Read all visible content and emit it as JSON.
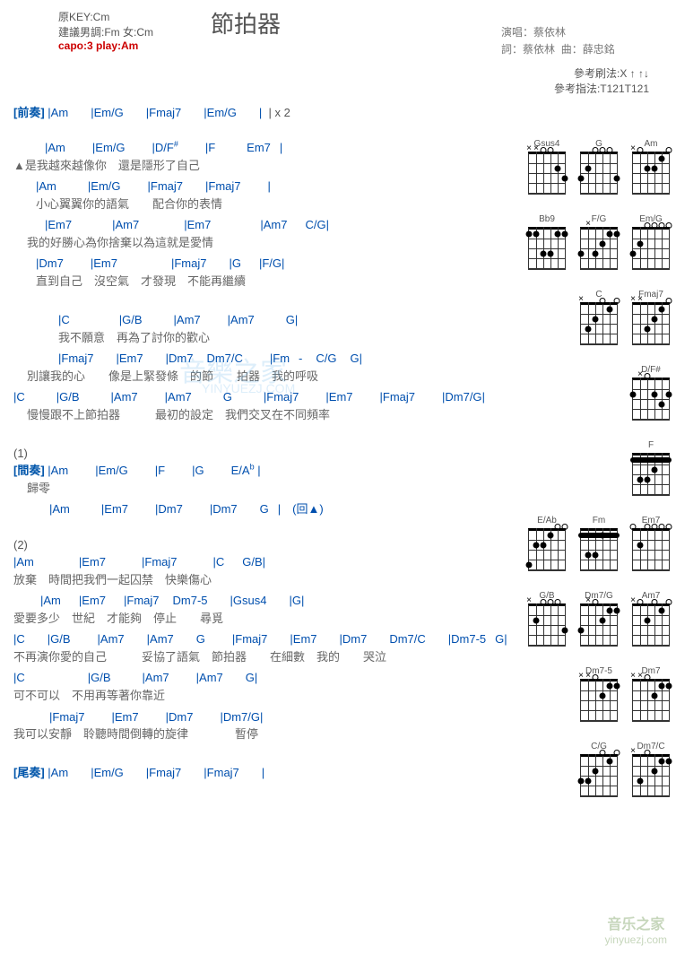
{
  "header": {
    "key": "原KEY:Cm",
    "suggest": "建議男調:Fm 女:Cm",
    "capo": "capo:3 play:Am",
    "title": "節拍器",
    "perf_lbl": "演唱：",
    "perf": "蔡依林",
    "lyric_lbl": "詞：",
    "lyric": "蔡依林",
    "comp_lbl": "曲：",
    "comp": "薛忠銘"
  },
  "refs": {
    "strum_lbl": "參考刷法:",
    "strum": "X ↑  ↑↓",
    "pick_lbl": "參考指法:",
    "pick": "T121T121",
    "bold_part": "↑"
  },
  "chart_data": {
    "type": "chord-sheet",
    "sections": [
      {
        "label": "[前奏]",
        "bars": [
          "|Am",
          "|Em/G",
          "|Fmaj7",
          "|Em/G",
          "|"
        ],
        "repeat": "| x 2"
      },
      {
        "label": "▲",
        "pairs": [
          {
            "chords": [
              "|Am",
              "|Em/G",
              "|D/F",
              "|F",
              "Em7",
              "|"
            ],
            "sup": "#",
            "sup_after": 2,
            "pad": [
              30,
              30,
              30,
              35,
              10,
              0
            ],
            "lyric": "是我越來越像你　還是隱形了自己"
          },
          {
            "chords": [
              "|Am",
              "|Em/G",
              "|Fmaj7",
              "|Fmaj7",
              "|"
            ],
            "pad": [
              35,
              30,
              25,
              30,
              0
            ],
            "lyric": "小心翼翼你的語氣　　配合你的表情",
            "lpad": 25
          },
          {
            "chords": [
              "|Em7",
              "|Am7",
              "|Em7",
              "|Am7",
              "C/G",
              "|"
            ],
            "pad": [
              45,
              50,
              55,
              20,
              0
            ],
            "lyric": "我的好勝心為你捨棄以為這就是愛情"
          },
          {
            "chords": [
              "|Dm7",
              "|Em7",
              "|Fmaj7",
              "|G",
              "|F/G",
              "|"
            ],
            "pad": [
              30,
              60,
              25,
              20,
              0
            ],
            "lyric": "直到自己　沒空氣　才發現　不能再繼續",
            "lpad": 25
          }
        ]
      },
      {
        "chorus": [
          {
            "chords": [
              "|C",
              "|G/B",
              "|Am7",
              "|Am7",
              "G",
              "|"
            ],
            "pad": [
              55,
              35,
              30,
              35,
              0
            ],
            "lyric": "我不願意　再為了討你的歡心",
            "lpad": 50,
            "cpad": 50
          },
          {
            "chords": [
              "|Fmaj7",
              "|Em7",
              "|Dm7",
              "Dm7/C",
              "|Fm",
              "-",
              "C/G",
              "G",
              "|"
            ],
            "pad": [
              25,
              25,
              15,
              30,
              10,
              15,
              15,
              0
            ],
            "lyric": "別讓我的心　　像是上緊發條　的節　　拍器　我的呼吸",
            "lpad": 15,
            "cpad": 50
          },
          {
            "chords": [
              "|C",
              "|G/B",
              "|Am7",
              "|Am7",
              "G",
              "|Fmaj7",
              "|Em7",
              "|Fmaj7",
              "|Dm7/G",
              "|"
            ],
            "pad": [
              35,
              35,
              30,
              35,
              35,
              30,
              30,
              30,
              0
            ],
            "lyric": "慢慢跟不上節拍器　　　最初的設定　我們交叉在不同頻率",
            "lpad": 15
          }
        ]
      },
      {
        "num": "(1)",
        "label": "[間奏]",
        "bars": [
          "|Am",
          "|Em/G",
          "|F",
          "|G",
          "E/A"
        ],
        "sup": "b",
        "lyric": "歸零",
        "lpad": 15,
        "line2": {
          "chords": [
            "|Am",
            "|Em7",
            "|Dm7",
            "|Dm7",
            "G",
            "|　(回▲)"
          ],
          "pad": [
            35,
            30,
            30,
            25,
            10,
            0
          ],
          "cpad": 40
        }
      },
      {
        "num": "(2)",
        "pairs": [
          {
            "chords": [
              "|Am",
              "|Em7",
              "|Fmaj7",
              "|C",
              "G/B",
              "|"
            ],
            "pad": [
              50,
              40,
              40,
              20,
              0
            ],
            "lyric": "放棄　時間把我們一起囚禁　快樂傷心"
          },
          {
            "chords": [
              "|Am",
              "|Em7",
              "|Fmaj7",
              "Dm7-5",
              "|Gsus4",
              "|G",
              "|"
            ],
            "pad": [
              20,
              20,
              15,
              25,
              25,
              0
            ],
            "lyric": "愛要多少　世紀　才能夠　停止　　尋覓",
            "lpad": 0,
            "cpad": 30
          },
          {
            "chords": [
              "|C",
              "|G/B",
              "|Am7",
              "|Am7",
              "G",
              "|Fmaj7",
              "|Em7",
              "|Dm7",
              "Dm7/C",
              "|Dm7-5",
              "G",
              "|"
            ],
            "pad": [
              25,
              30,
              25,
              25,
              30,
              25,
              25,
              25,
              25,
              10,
              0
            ],
            "lyric": "不再演你愛的自己　　　妥協了語氣　節拍器　　在細數　我的　　哭泣"
          },
          {
            "chords": [
              "|C",
              "|G/B",
              "|Am7",
              "|Am7",
              "G",
              "|"
            ],
            "pad": [
              70,
              35,
              30,
              25,
              0
            ],
            "lyric": "可不可以　不用再等著你靠近"
          },
          {
            "chords": [
              "|Fmaj7",
              "|Em7",
              "|Dm7",
              "|Dm7/G",
              "|"
            ],
            "pad": [
              30,
              30,
              30,
              0
            ],
            "lyric": "我可以安靜　聆聽時間倒轉的旋律　　　　暫停",
            "cpad": 40
          }
        ]
      },
      {
        "label": "[尾奏]",
        "bars": [
          "|Am",
          "|Em/G",
          "|Fmaj7",
          "|Fmaj7",
          "|"
        ]
      }
    ]
  },
  "diags": [
    [
      {
        "n": "Gsus4",
        "d": [
          "m1",
          "m2",
          "o3",
          "o4",
          "df2s5",
          "df3s6"
        ]
      },
      {
        "n": "G",
        "d": [
          "df3s1",
          "df2s2",
          "o3",
          "o4",
          "o5",
          "df3s6"
        ]
      },
      {
        "n": "Am",
        "d": [
          "m1",
          "o2",
          "df2s3",
          "df2s4",
          "df1s5",
          "o6"
        ]
      }
    ],
    [
      {
        "n": "Bb9",
        "d": [
          "df1s1",
          "df1s2",
          "df1s5",
          "df1s6",
          "df3s3",
          "df3s4"
        ]
      },
      {
        "n": "F/G",
        "d": [
          "df3s1",
          "m2",
          "df3s3",
          "df2s4",
          "df1s5",
          "df1s6"
        ]
      },
      {
        "n": "Em/G",
        "d": [
          "df3s1",
          "df2s2",
          "o3",
          "o4",
          "o5",
          "o6"
        ]
      }
    ],
    [
      {
        "n": "C",
        "d": [
          "m1",
          "df3s2",
          "df2s3",
          "o4",
          "df1s5",
          "o6"
        ]
      },
      {
        "n": "Fmaj7",
        "d": [
          "m1",
          "m2",
          "df3s3",
          "df2s4",
          "df1s5",
          "o6"
        ]
      }
    ],
    [
      {
        "n": "D/F#",
        "d": [
          "df2s1",
          "m2",
          "o3",
          "df2s4",
          "df3s5",
          "df2s6"
        ]
      }
    ],
    [
      {
        "n": "F",
        "d": [
          "bar1",
          "df3s2",
          "df3s3",
          "df2s4"
        ]
      }
    ],
    [
      {
        "n": "E/Ab",
        "d": [
          "df4s1",
          "df2s2",
          "df2s3",
          "df1s4",
          "o5",
          "o6"
        ]
      },
      {
        "n": "Fm",
        "d": [
          "bar1",
          "df3s2",
          "df3s3",
          "df1s4"
        ]
      },
      {
        "n": "Em7",
        "d": [
          "o1",
          "df2s2",
          "o3",
          "o4",
          "o5",
          "o6"
        ]
      }
    ],
    [
      {
        "n": "G/B",
        "d": [
          "m1",
          "df2s2",
          "o3",
          "o4",
          "o5",
          "df3s6"
        ]
      },
      {
        "n": "Dm7/G",
        "d": [
          "df3s1",
          "m2",
          "o3",
          "df2s4",
          "df1s5",
          "df1s6"
        ]
      },
      {
        "n": "Am7",
        "d": [
          "m1",
          "o2",
          "df2s3",
          "o4",
          "df1s5",
          "o6"
        ]
      }
    ],
    [
      {
        "n": "Dm7-5",
        "d": [
          "m1",
          "m2",
          "o3",
          "df2s4",
          "df1s5",
          "df1s6"
        ]
      },
      {
        "n": "Dm7",
        "d": [
          "m1",
          "m2",
          "o3",
          "df2s4",
          "df1s5",
          "df1s6"
        ]
      }
    ],
    [
      {
        "n": "C/G",
        "d": [
          "df3s1",
          "df3s2",
          "df2s3",
          "o4",
          "df1s5",
          "o6"
        ]
      },
      {
        "n": "Dm7/C",
        "d": [
          "m1",
          "df3s2",
          "o3",
          "df2s4",
          "df1s5",
          "df1s6"
        ]
      }
    ]
  ],
  "wm": {
    "cn": "音樂之家",
    "en": "YINYUEZJ.COM",
    "logo_cn": "音乐之家",
    "logo_en": "yinyuezj.com"
  }
}
